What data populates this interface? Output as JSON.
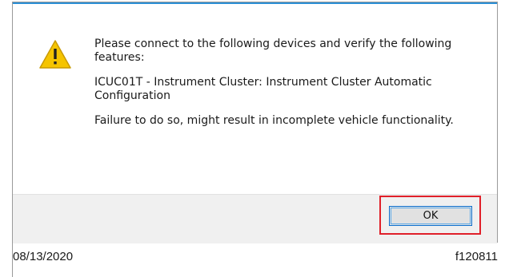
{
  "dialog": {
    "icon": "warning-icon",
    "message": {
      "line1": "Please connect to the following devices and verify the following features:",
      "line2": "ICUC01T - Instrument Cluster: Instrument Cluster Automatic Configuration",
      "line3": "Failure to do so, might result in incomplete vehicle functionality."
    },
    "ok_label": "OK"
  },
  "caption": {
    "date": "08/13/2020",
    "reference": "f120811"
  },
  "colors": {
    "highlight": "#e0202a",
    "warning_fill": "#f5c400",
    "button_border": "#0a6fd0"
  }
}
